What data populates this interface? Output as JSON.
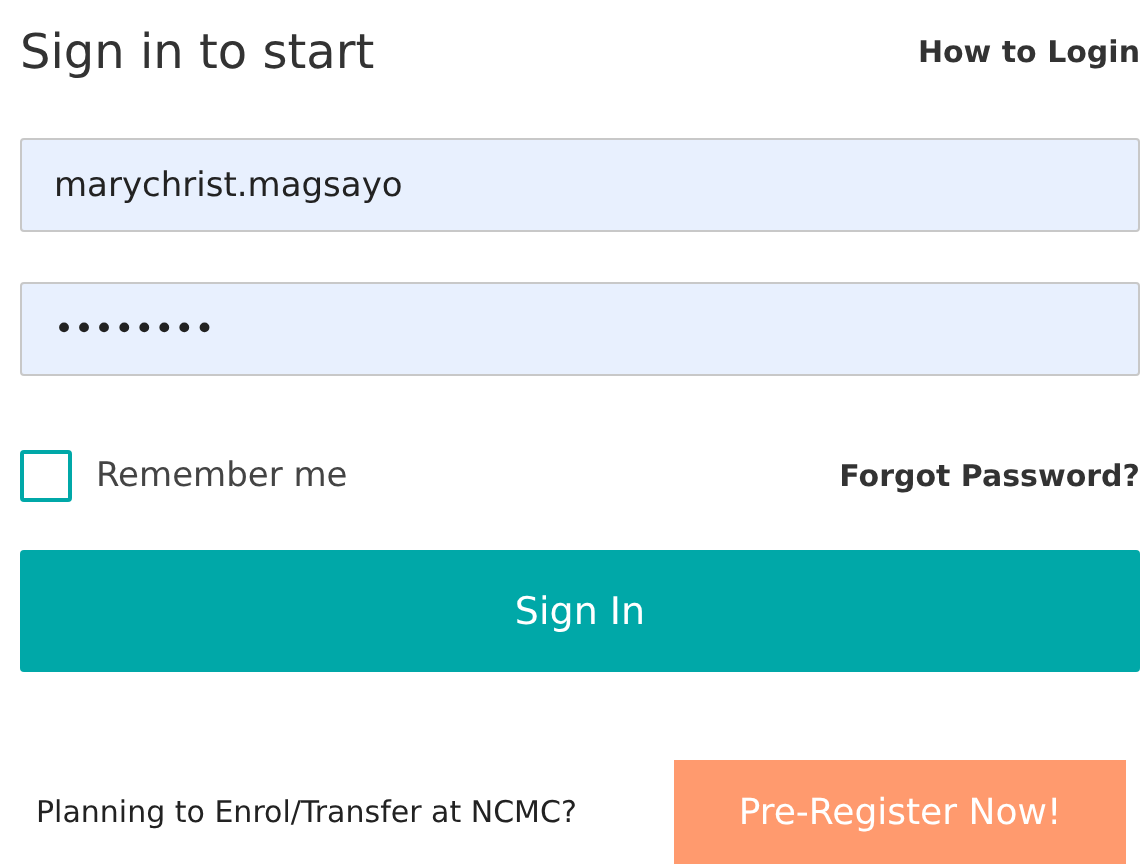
{
  "title": "Sign in to start",
  "help_link": "How to Login",
  "username": {
    "value": "marychrist.magsayo"
  },
  "password": {
    "value": "••••••••"
  },
  "remember": {
    "label": "Remember me",
    "checked": false
  },
  "forgot_link": "Forgot Password?",
  "sign_in_button": "Sign In",
  "prompt": "Planning to Enrol/Transfer at NCMC?",
  "register_button": "Pre-Register Now!"
}
